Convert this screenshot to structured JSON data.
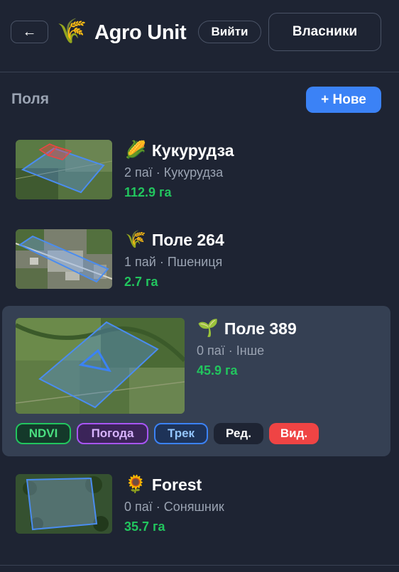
{
  "header": {
    "back_label": "←",
    "logo_icon": "🌾",
    "title": "Agro Unit",
    "logout_label": "Вийти",
    "owners_label": "Власники"
  },
  "section": {
    "title": "Поля",
    "new_label": "+ Нове"
  },
  "fields": [
    {
      "emoji": "🌽",
      "name": "Кукурудза",
      "meta": "2 паї · Кукурудза",
      "area": "112.9 га",
      "thumb": "field-map-1"
    },
    {
      "emoji": "🌾",
      "name": "Поле 264",
      "meta": "1 пай · Пшениця",
      "area": "2.7 га",
      "thumb": "field-map-2"
    },
    {
      "emoji": "🌱",
      "name": "Поле 389",
      "meta": "0 паї · Інше",
      "area": "45.9 га",
      "thumb": "field-map-3",
      "selected": true
    },
    {
      "emoji": "🌻",
      "name": "Forest",
      "meta": "0 паї · Соняшник",
      "area": "35.7 га",
      "thumb": "field-map-4"
    }
  ],
  "actions": {
    "ndvi": "NDVI",
    "weather": "Погода",
    "track": "Трек",
    "edit": "Ред.",
    "delete": "Вид."
  },
  "colors": {
    "background": "#1e2433",
    "accent": "#3b82f6",
    "area_green": "#22c55e",
    "delete_red": "#ef4444",
    "selected_card": "#354053"
  }
}
